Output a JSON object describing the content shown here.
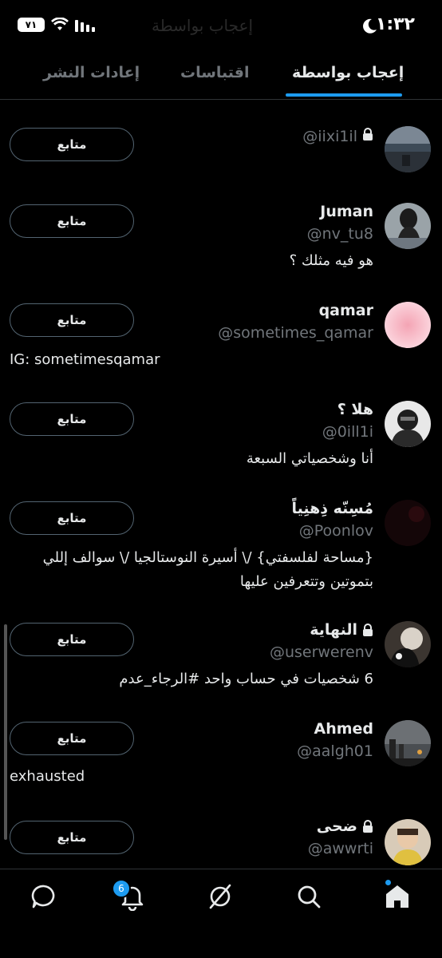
{
  "status_bar": {
    "time": "١:٣٢",
    "battery": "٧١",
    "faded_title": "إعجاب بواسطة"
  },
  "tabs": [
    {
      "label": "إعجاب بواسطة",
      "active": true
    },
    {
      "label": "اقتباسات",
      "active": false
    },
    {
      "label": "إعادات النشر",
      "active": false
    }
  ],
  "follow_label": "متابع",
  "users": [
    {
      "name": "",
      "locked": true,
      "handle": "@iixi1il",
      "bio": ""
    },
    {
      "name": "Juman",
      "locked": false,
      "handle": "@nv_tu8",
      "bio": "هو فيه مثلك ؟"
    },
    {
      "name": "qamar",
      "locked": false,
      "handle": "@sometimes_qamar",
      "bio": "IG: sometimesqamar"
    },
    {
      "name": "هلا ؟",
      "locked": false,
      "handle": "@0ill1i",
      "bio": "أنا وشخصياتي السبعة"
    },
    {
      "name": "مُسِنّه ذِهنِياً",
      "locked": false,
      "handle": "@Poonlov",
      "bio": "{مساحة لفلسفتي} /\\ أسيرة النوستالجيا /\\ سوالف إللي بتموتين وتتعرفين عليها"
    },
    {
      "name": "النهاية",
      "locked": true,
      "handle": "@userwerenv",
      "bio": "6 شخصيات في حساب واحد #الرجاء_عدم"
    },
    {
      "name": "Ahmed",
      "locked": false,
      "handle": "@aalgh01",
      "bio": "exhausted"
    },
    {
      "name": "ضحى",
      "locked": true,
      "handle": "@awwrti",
      "bio": ""
    }
  ],
  "nav": {
    "notifications_badge": "6"
  },
  "colors": {
    "accent": "#1d9bf0",
    "background": "#000000",
    "secondary_text": "#71767b"
  }
}
